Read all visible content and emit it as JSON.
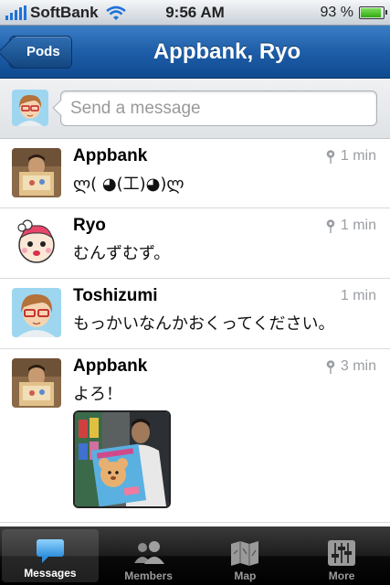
{
  "status_bar": {
    "carrier": "SoftBank",
    "time": "9:56 AM",
    "battery": "93 %",
    "battery_level": 0.93
  },
  "nav": {
    "back_label": "Pods",
    "title": "Appbank, Ryo"
  },
  "compose": {
    "placeholder": "Send a message"
  },
  "messages": [
    {
      "name": "Appbank",
      "text": "ლ( ◕(工)◕)ლ",
      "time": "1 min",
      "has_location": true
    },
    {
      "name": "Ryo",
      "text": "むんずむず。",
      "time": "1 min",
      "has_location": true
    },
    {
      "name": "Toshizumi",
      "text": "もっかいなんかおくってください。",
      "time": "1 min",
      "has_location": false
    },
    {
      "name": "Appbank",
      "text": "よろ！",
      "time": "3 min",
      "has_location": true,
      "has_photo": true
    }
  ],
  "tabs": [
    {
      "label": "Messages",
      "icon": "speech-bubble-icon",
      "active": true
    },
    {
      "label": "Members",
      "icon": "people-icon",
      "active": false
    },
    {
      "label": "Map",
      "icon": "map-icon",
      "active": false
    },
    {
      "label": "More",
      "icon": "sliders-icon",
      "active": false
    }
  ],
  "colors": {
    "nav_blue": "#1e5ea8",
    "tab_active_icon": "#5fb4ee"
  }
}
